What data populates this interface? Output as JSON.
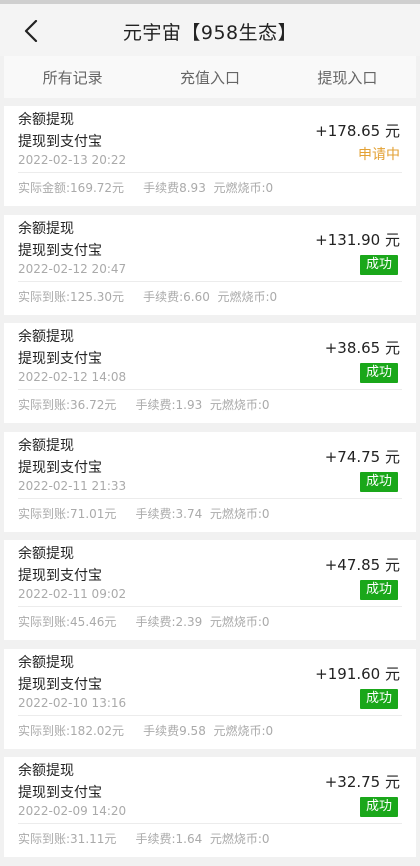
{
  "header": {
    "title": "元宇宙【958生态】"
  },
  "tabs": [
    "所有记录",
    "充值入口",
    "提现入口"
  ],
  "records": [
    {
      "type": "余额提现",
      "method": "提现到支付宝",
      "time": "2022-02-13  20:22",
      "amount": "+178.65 元",
      "status": "申请中",
      "status_style": "pending",
      "detail": "实际金额:169.72元     手续费8.93  元燃烧币:0"
    },
    {
      "type": "余额提现",
      "method": "提现到支付宝",
      "time": "2022-02-12  20:47",
      "amount": "+131.90 元",
      "status": "成功",
      "status_style": "success",
      "detail": "实际到账:125.30元     手续费:6.60  元燃烧币:0"
    },
    {
      "type": "余额提现",
      "method": "提现到支付宝",
      "time": "2022-02-12  14:08",
      "amount": "+38.65 元",
      "status": "成功",
      "status_style": "success",
      "detail": "实际到账:36.72元     手续费:1.93  元燃烧币:0"
    },
    {
      "type": "余额提现",
      "method": "提现到支付宝",
      "time": "2022-02-11  21:33",
      "amount": "+74.75 元",
      "status": "成功",
      "status_style": "success",
      "detail": "实际到账:71.01元     手续费:3.74  元燃烧币:0"
    },
    {
      "type": "余额提现",
      "method": "提现到支付宝",
      "time": "2022-02-11  09:02",
      "amount": "+47.85 元",
      "status": "成功",
      "status_style": "success",
      "detail": "实际到账:45.46元     手续费:2.39  元燃烧币:0"
    },
    {
      "type": "余额提现",
      "method": "提现到支付宝",
      "time": "2022-02-10  13:16",
      "amount": "+191.60 元",
      "status": "成功",
      "status_style": "success",
      "detail": "实际到账:182.02元     手续费9.58  元燃烧币:0"
    },
    {
      "type": "余额提现",
      "method": "提现到支付宝",
      "time": "2022-02-09  14:20",
      "amount": "+32.75 元",
      "status": "成功",
      "status_style": "success",
      "detail": "实际到账:31.11元     手续费:1.64  元燃烧币:0"
    }
  ],
  "colors": {
    "success_badge": "#1aa71a",
    "pending_text": "#e3a134"
  }
}
